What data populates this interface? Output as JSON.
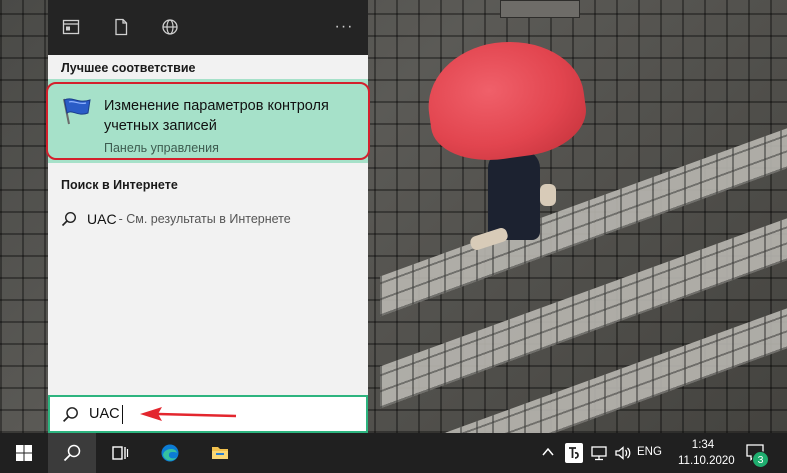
{
  "search_panel": {
    "topbar": {
      "apps_icon": "apps-filter-icon",
      "docs_icon": "documents-filter-icon",
      "web_icon": "web-filter-icon",
      "more_label": "···"
    },
    "best_match": {
      "heading": "Лучшее соответствие",
      "title": "Изменение параметров контроля учетных записей",
      "subtitle": "Панель управления",
      "icon": "uac-flag-icon"
    },
    "web_search": {
      "heading": "Поиск в Интернете",
      "term": "UAC",
      "hint": "- См. результаты в Интернете"
    },
    "search_box": {
      "value": "UAC"
    }
  },
  "taskbar": {
    "language": "ENG",
    "time": "1:34",
    "date": "11.10.2020",
    "notification_count": "3"
  },
  "colors": {
    "accent_green": "#2db47f",
    "best_match_bg": "#a6e1c9",
    "annotation_red": "#d4202c",
    "taskbar_bg": "#202020"
  }
}
